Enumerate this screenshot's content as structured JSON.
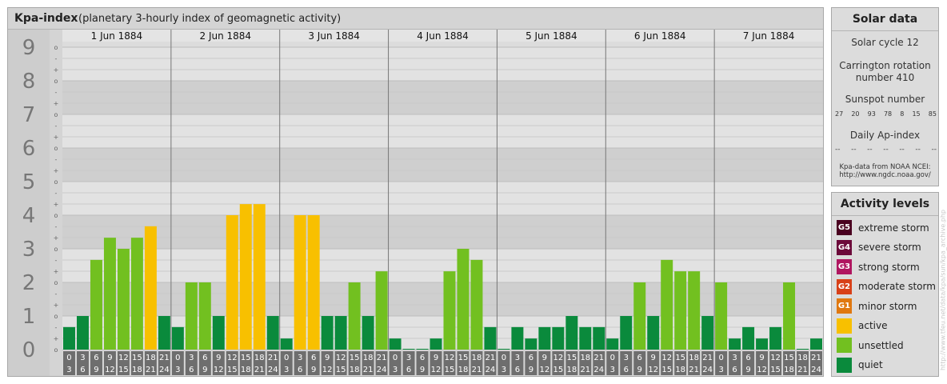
{
  "chart_data": {
    "type": "bar",
    "title": "Kpa-index",
    "subtitle": "(planetary 3-hourly index of geomagnetic activity)",
    "ylim": [
      0,
      9
    ],
    "y_ticks": [
      "0",
      "1",
      "2",
      "3",
      "4",
      "5",
      "6",
      "7",
      "8",
      "9"
    ],
    "minor_tick_marks": [
      "-",
      "o",
      "+"
    ],
    "days": [
      "1 Jun 1884",
      "2 Jun 1884",
      "3 Jun 1884",
      "4 Jun 1884",
      "5 Jun 1884",
      "6 Jun 1884",
      "7 Jun 1884"
    ],
    "interval_starts": [
      "0",
      "3",
      "6",
      "9",
      "12",
      "15",
      "18",
      "21"
    ],
    "interval_ends": [
      "3",
      "6",
      "9",
      "12",
      "15",
      "18",
      "21",
      "24"
    ],
    "values": [
      [
        0.67,
        1.0,
        2.67,
        3.33,
        3.0,
        3.33,
        3.67,
        1.0
      ],
      [
        0.67,
        2.0,
        2.0,
        1.0,
        4.0,
        4.33,
        4.33,
        1.0
      ],
      [
        0.33,
        4.0,
        4.0,
        1.0,
        1.0,
        2.0,
        1.0,
        2.33
      ],
      [
        0.33,
        0.0,
        0.0,
        0.33,
        2.33,
        3.0,
        2.67,
        0.67
      ],
      [
        0.0,
        0.67,
        0.33,
        0.67,
        0.67,
        1.0,
        0.67,
        0.67
      ],
      [
        0.33,
        1.0,
        2.0,
        1.0,
        2.67,
        2.33,
        2.33,
        1.0
      ],
      [
        2.0,
        0.33,
        0.67,
        0.33,
        0.67,
        2.0,
        0.0,
        0.33
      ]
    ],
    "colors": {
      "quiet": "#0a8a3c",
      "unsettled": "#72c020",
      "active": "#f8c000"
    },
    "grid": true
  },
  "solar": {
    "header": "Solar data",
    "cycle": "Solar cycle 12",
    "carrington_line1": "Carrington rotation",
    "carrington_line2": "number 410",
    "sunspot_label": "Sunspot number",
    "sunspot_values": [
      "27",
      "20",
      "93",
      "78",
      "8",
      "15",
      "85"
    ],
    "ap_label": "Daily Ap-index",
    "ap_values": [
      "--",
      "--",
      "--",
      "--",
      "--",
      "--",
      "--"
    ],
    "source_line1": "Kpa-data from NOAA NCEI:",
    "source_line2": "http://www.ngdc.noaa.gov/"
  },
  "levels": {
    "header": "Activity levels",
    "items": [
      {
        "code": "G5",
        "label": "extreme storm",
        "color": "#4a0020"
      },
      {
        "code": "G4",
        "label": "severe storm",
        "color": "#6c0a3a"
      },
      {
        "code": "G3",
        "label": "strong storm",
        "color": "#b01660"
      },
      {
        "code": "G2",
        "label": "moderate storm",
        "color": "#d84018"
      },
      {
        "code": "G1",
        "label": "minor storm",
        "color": "#e07810"
      },
      {
        "code": "",
        "label": "active",
        "color": "#f8c000"
      },
      {
        "code": "",
        "label": "unsettled",
        "color": "#72c020"
      },
      {
        "code": "",
        "label": "quiet",
        "color": "#0a8a3c"
      }
    ]
  },
  "watermark": "http://www.tfeu.net/data/kpa/sun/kpa_archive.php"
}
